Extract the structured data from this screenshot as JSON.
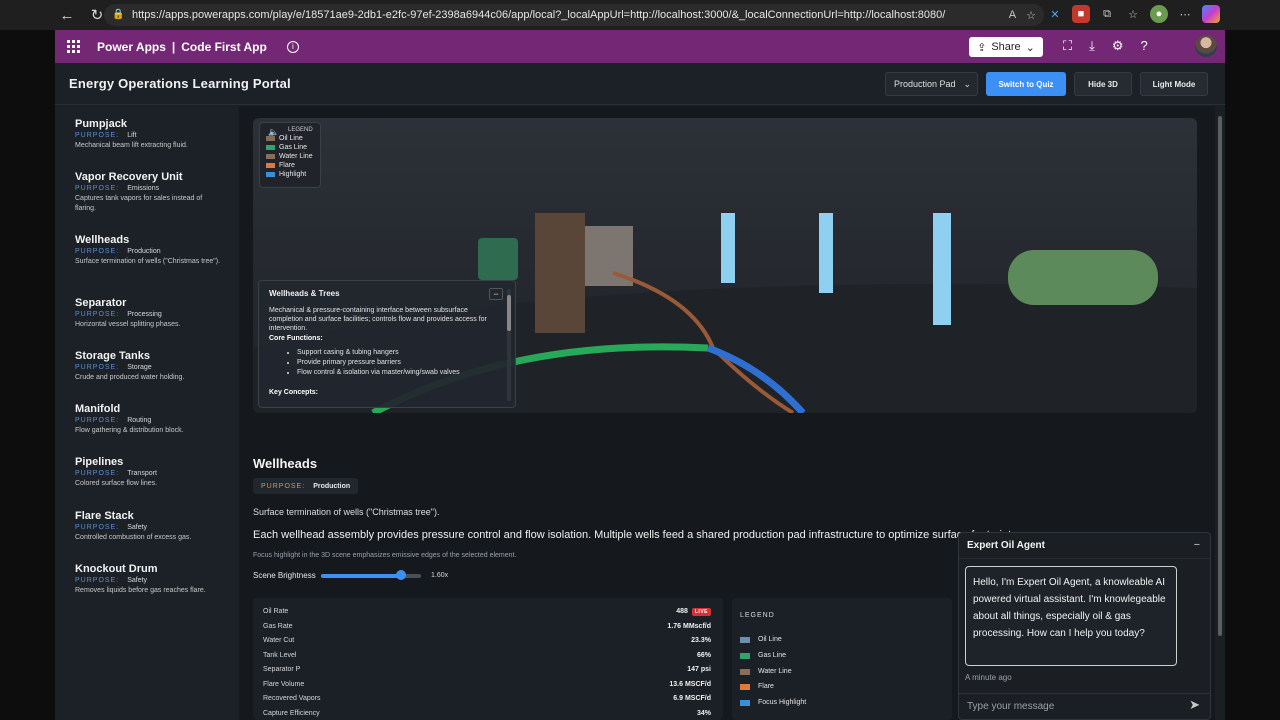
{
  "browser": {
    "url": "https://apps.powerapps.com/play/e/18571ae9-2db1-e2fc-97ef-2398a6944c06/app/local?_localAppUrl=http://localhost:3000/&_localConnectionUrl=http://localhost:8080/"
  },
  "powerapps": {
    "product": "Power Apps",
    "separator": "|",
    "app_name": "Code First App",
    "share_label": "Share"
  },
  "portal": {
    "title": "Energy Operations Learning Portal",
    "pad_select": "Production Pad",
    "quiz_button": "Switch to Quiz",
    "hide3d_button": "Hide 3D",
    "lightmode_button": "Light Mode"
  },
  "sidebar": {
    "purpose_label": "PURPOSE:",
    "items": [
      {
        "name": "Pumpjack",
        "purpose": "Lift",
        "desc": "Mechanical beam lift extracting fluid."
      },
      {
        "name": "Vapor Recovery Unit",
        "purpose": "Emissions",
        "desc": "Captures tank vapors for sales instead of flaring."
      },
      {
        "name": "Wellheads",
        "purpose": "Production",
        "desc": "Surface termination of wells (\"Christmas tree\")."
      },
      {
        "name": "Separator",
        "purpose": "Processing",
        "desc": "Horizontal vessel splitting phases."
      },
      {
        "name": "Storage Tanks",
        "purpose": "Storage",
        "desc": "Crude and produced water holding."
      },
      {
        "name": "Manifold",
        "purpose": "Routing",
        "desc": "Flow gathering & distribution block."
      },
      {
        "name": "Pipelines",
        "purpose": "Transport",
        "desc": "Colored surface flow lines."
      },
      {
        "name": "Flare Stack",
        "purpose": "Safety",
        "desc": "Controlled combustion of excess gas."
      },
      {
        "name": "Knockout Drum",
        "purpose": "Safety",
        "desc": "Removes liquids before gas reaches flare."
      }
    ]
  },
  "scene": {
    "legend_title": "LEGEND",
    "legend": [
      {
        "label": "Oil Line",
        "color": "#8a6a52"
      },
      {
        "label": "Gas Line",
        "color": "#2fa36b"
      },
      {
        "label": "Water Line",
        "color": "#8b6d58"
      },
      {
        "label": "Flare",
        "color": "#e07a3a"
      },
      {
        "label": "Highlight",
        "color": "#3a8fd6"
      }
    ],
    "info_title": "Wellheads & Trees",
    "info_body": "Mechanical & pressure-containing interface between subsurface completion and surface facilities; controls flow and provides access for intervention.",
    "info_core_label": "Core Functions:",
    "info_functions": [
      "Support casing & tubing hangers",
      "Provide primary pressure barriers",
      "Flow control & isolation via master/wing/swab valves"
    ],
    "info_concepts_label": "Key Concepts:"
  },
  "detail": {
    "title": "Wellheads",
    "purpose_label": "PURPOSE:",
    "purpose_value": "Production",
    "short_desc": "Surface termination of wells (\"Christmas tree\").",
    "long_desc": "Each wellhead assembly provides pressure control and flow isolation. Multiple wells feed a shared production pad infrastructure to optimize surface footprint.",
    "note": "Focus highlight in the 3D scene emphasizes emissive edges of the selected element.",
    "brightness_label": "Scene Brightness",
    "brightness_value": "1.60x",
    "brightness_fraction": 0.8
  },
  "metrics": {
    "live_badge": "LIVE",
    "rows": [
      {
        "label": "Oil Rate",
        "value": "488"
      },
      {
        "label": "Gas Rate",
        "value": "1.76 MMscf/d"
      },
      {
        "label": "Water Cut",
        "value": "23.3%"
      },
      {
        "label": "Tank Level",
        "value": "66%"
      },
      {
        "label": "Separator P",
        "value": "147 psi"
      },
      {
        "label": "Flare Volume",
        "value": "13.6 MSCF/d"
      },
      {
        "label": "Recovered Vapors",
        "value": "6.9 MSCF/d"
      },
      {
        "label": "Capture Efficiency",
        "value": "34%"
      }
    ]
  },
  "legend_panel": {
    "title": "LEGEND",
    "items": [
      {
        "label": "Oil Line",
        "color": "#6f8fb0"
      },
      {
        "label": "Gas Line",
        "color": "#2fa36b"
      },
      {
        "label": "Water Line",
        "color": "#8b6d58"
      },
      {
        "label": "Flare",
        "color": "#e07a3a"
      },
      {
        "label": "Focus Highlight",
        "color": "#3a8fd6"
      }
    ]
  },
  "chat": {
    "title": "Expert Oil Agent",
    "message": "Hello, I'm Expert Oil Agent, a knowleable AI powered virtual assistant. I'm knowlegeable about all things, especially oil & gas processing. How can I help you today?",
    "time": "A minute ago",
    "placeholder": "Type your message"
  }
}
